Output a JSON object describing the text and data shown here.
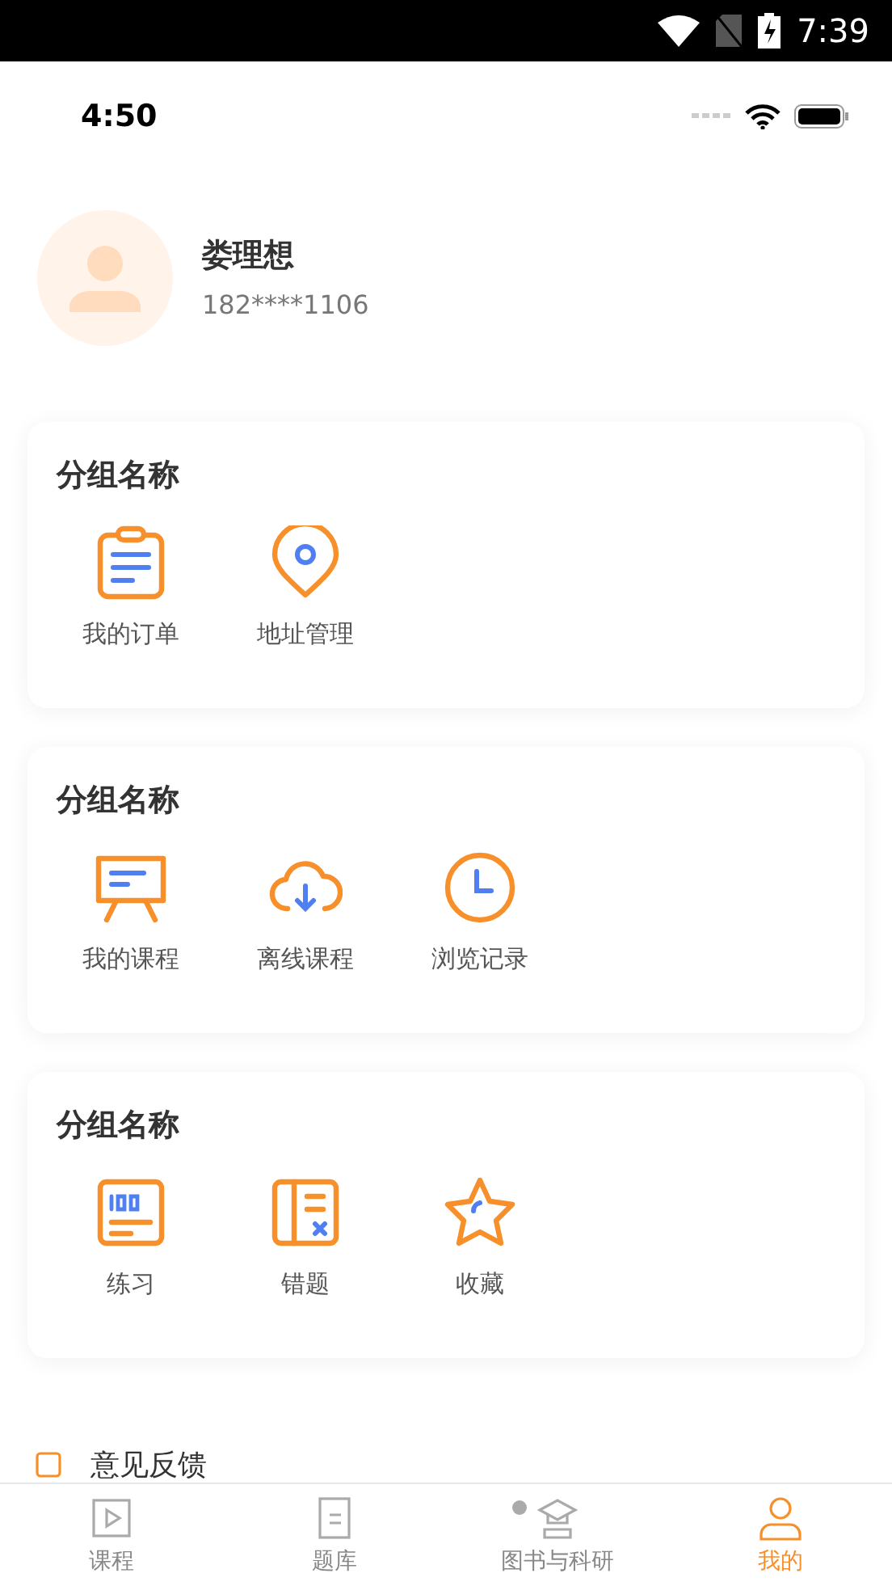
{
  "system_bar": {
    "time": "7:39"
  },
  "app_status_bar": {
    "time": "4:50"
  },
  "profile": {
    "name": "娄理想",
    "phone": "182****1106"
  },
  "groups": [
    {
      "title": "分组名称",
      "items": [
        {
          "label": "我的订单",
          "kind": "clipboard"
        },
        {
          "label": "地址管理",
          "kind": "pin"
        }
      ]
    },
    {
      "title": "分组名称",
      "items": [
        {
          "label": "我的课程",
          "kind": "easel"
        },
        {
          "label": "离线课程",
          "kind": "cloud"
        },
        {
          "label": "浏览记录",
          "kind": "clock"
        }
      ]
    },
    {
      "title": "分组名称",
      "items": [
        {
          "label": "练习",
          "kind": "score"
        },
        {
          "label": "错题",
          "kind": "mistake"
        },
        {
          "label": "收藏",
          "kind": "star"
        }
      ]
    }
  ],
  "list_rows": [
    {
      "label": "意见反馈"
    }
  ],
  "tabs": [
    {
      "label": "课程",
      "kind": "play",
      "selected": false,
      "dot": false
    },
    {
      "label": "题库",
      "kind": "doc",
      "selected": false,
      "dot": false
    },
    {
      "label": "图书与科研",
      "kind": "cap",
      "selected": false,
      "dot": true
    },
    {
      "label": "我的",
      "kind": "user",
      "selected": true,
      "dot": false
    }
  ]
}
